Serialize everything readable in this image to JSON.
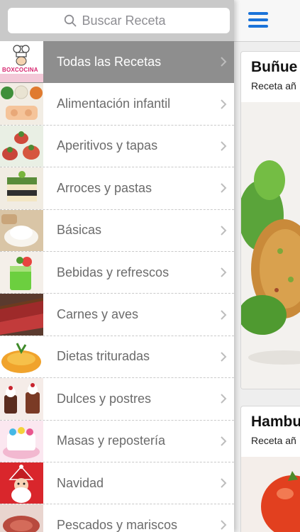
{
  "search": {
    "placeholder": "Buscar Receta"
  },
  "sidebar": {
    "items": [
      {
        "label": "Todas las Recetas",
        "thumb": "boxcocina-logo",
        "active": true
      },
      {
        "label": "Alimentación infantil",
        "thumb": "baby-food-photo"
      },
      {
        "label": "Aperitivos y tapas",
        "thumb": "tapas-photo"
      },
      {
        "label": "Arroces y pastas",
        "thumb": "rice-pasta-photo"
      },
      {
        "label": "Básicas",
        "thumb": "flour-photo"
      },
      {
        "label": "Bebidas y refrescos",
        "thumb": "drinks-photo"
      },
      {
        "label": "Carnes y aves",
        "thumb": "meat-photo"
      },
      {
        "label": "Dietas trituradas",
        "thumb": "puree-photo"
      },
      {
        "label": "Dulces y postres",
        "thumb": "desserts-photo"
      },
      {
        "label": "Masas y repostería",
        "thumb": "pastry-photo"
      },
      {
        "label": "Navidad",
        "thumb": "christmas-photo"
      },
      {
        "label": "Pescados y mariscos",
        "thumb": "seafood-photo"
      }
    ]
  },
  "logo": {
    "text": "BOXCOCINA"
  },
  "content": {
    "menu_icon": "hamburger-menu-icon",
    "cards": [
      {
        "title": "Buñue",
        "subtitle": "Receta añ",
        "image": "fritter-salad-photo"
      },
      {
        "title": "Hambu",
        "subtitle": "Receta añ",
        "image": "tomato-photo"
      }
    ]
  },
  "colors": {
    "accent": "#1a73d9",
    "active_row": "#8e8e8e",
    "search_bar_bg": "#c9c9c9"
  }
}
